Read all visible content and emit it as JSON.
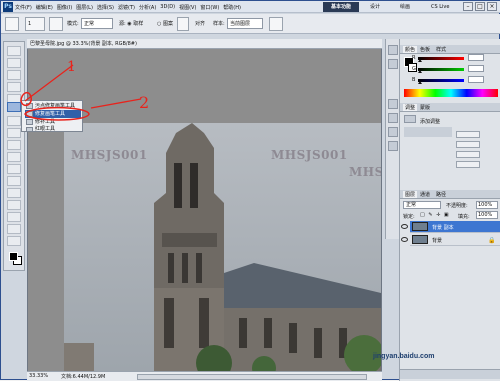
{
  "menubar": {
    "logo": "Ps",
    "items": [
      "文件(F)",
      "编辑(E)",
      "图像(I)",
      "图层(L)",
      "选择(S)",
      "滤镜(T)",
      "分析(A)",
      "3D(D)",
      "视图(V)",
      "窗口(W)",
      "帮助(H)"
    ],
    "zoom": "100%",
    "workspace_active": "基本功能",
    "workspace_2": "设计",
    "workspace_3": "绘画",
    "cs_live": "CS Live",
    "window_buttons": [
      "–",
      "□",
      "×"
    ]
  },
  "options": {
    "brush_size": "1",
    "mode_label": "模式:",
    "mode_value": "正常",
    "opacity_label": "不透明度:",
    "flow_label": "流量:",
    "aligned_label": "对齐",
    "sample_label": "样本:",
    "sample_value": "当前图层"
  },
  "document": {
    "tab_title": "巴黎圣母院.jpg @ 33.3%(背景 副本, RGB/8#)",
    "zoom": "33.33%",
    "info": "文档:6.44M/12.9M",
    "watermarks": [
      "MHSJS001",
      "MHSJS001",
      "MHSJS001",
      "MHSJS"
    ]
  },
  "flyout": {
    "items": [
      "污点修复画笔工具",
      "修复画笔工具",
      "修补工具",
      "红眼工具"
    ],
    "selected_index": 1
  },
  "annotations": {
    "label_1": "1",
    "label_2": "2",
    "color": "#e8231c"
  },
  "panels": {
    "color_tabs": [
      "颜色",
      "色板",
      "样式"
    ],
    "color_channels": [
      "R",
      "G",
      "B"
    ],
    "color_values": [
      "",
      "",
      ""
    ],
    "adjust_tabs": [
      "调整",
      "蒙版"
    ],
    "adjust_header": "添加调整",
    "layers_tabs": [
      "图层",
      "通道",
      "路径"
    ],
    "blend_mode": "正常",
    "opacity_label": "不透明度:",
    "opacity_value": "100%",
    "lock_label": "锁定:",
    "fill_label": "填充:",
    "fill_value": "100%",
    "layers": [
      {
        "name": "背景 副本",
        "selected": true
      },
      {
        "name": "背景",
        "selected": false
      }
    ]
  },
  "site_watermark": "jingyan.baidu.com"
}
